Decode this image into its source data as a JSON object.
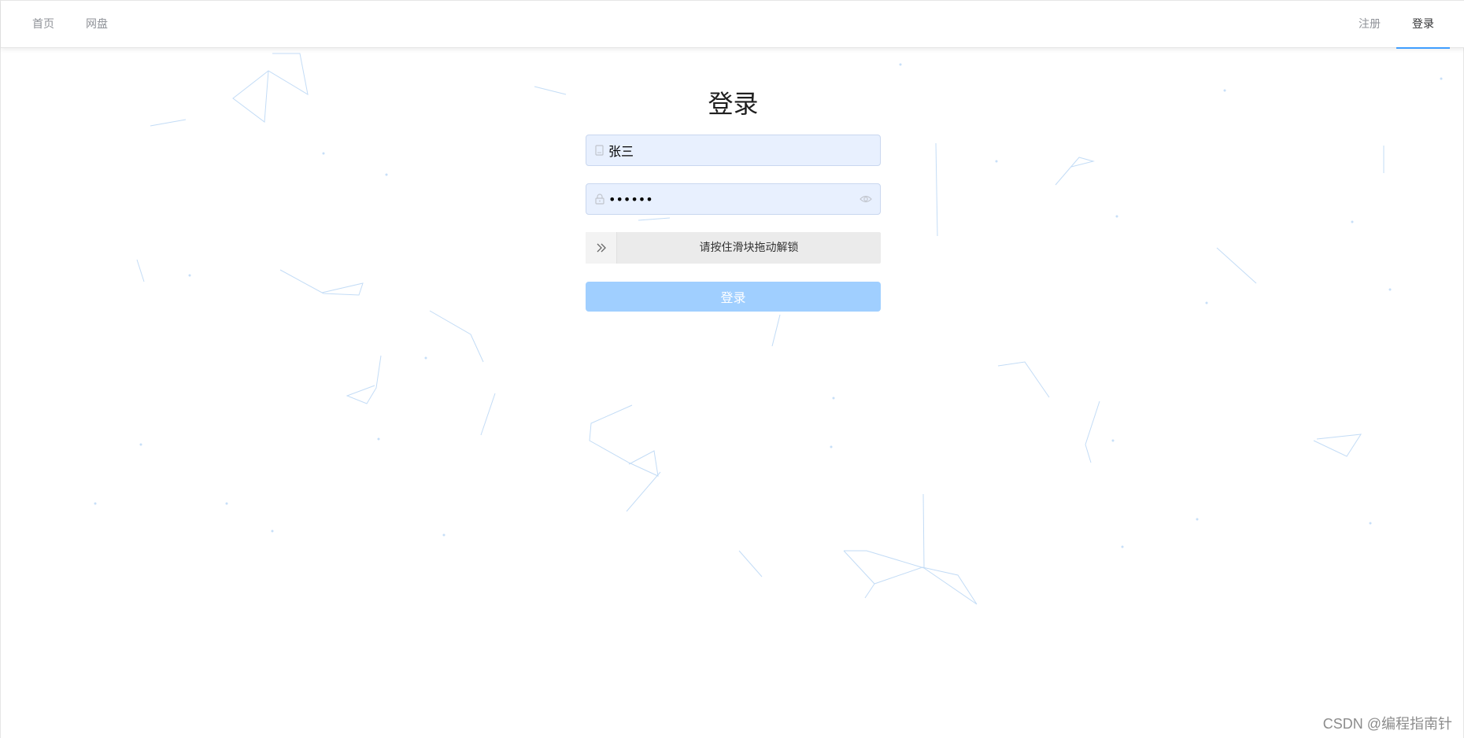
{
  "nav": {
    "left": [
      {
        "label": "首页"
      },
      {
        "label": "网盘"
      }
    ],
    "right": [
      {
        "label": "注册"
      },
      {
        "label": "登录",
        "active": true
      }
    ]
  },
  "login": {
    "title": "登录",
    "username": {
      "value": "张三",
      "icon": "user-icon"
    },
    "password": {
      "value": "123456",
      "icon": "lock-icon",
      "suffix_icon": "eye-icon"
    },
    "slider": {
      "hint": "请按住滑块拖动解锁",
      "icon": "double-chevron-right-icon"
    },
    "submit_label": "登录"
  },
  "watermark": "CSDN @编程指南针",
  "colors": {
    "accent": "#409eff",
    "button_disabled": "#a0cfff",
    "input_bg": "#e8f0fe",
    "slider_bg": "#ebebeb",
    "particle": "#bcd8f5"
  }
}
